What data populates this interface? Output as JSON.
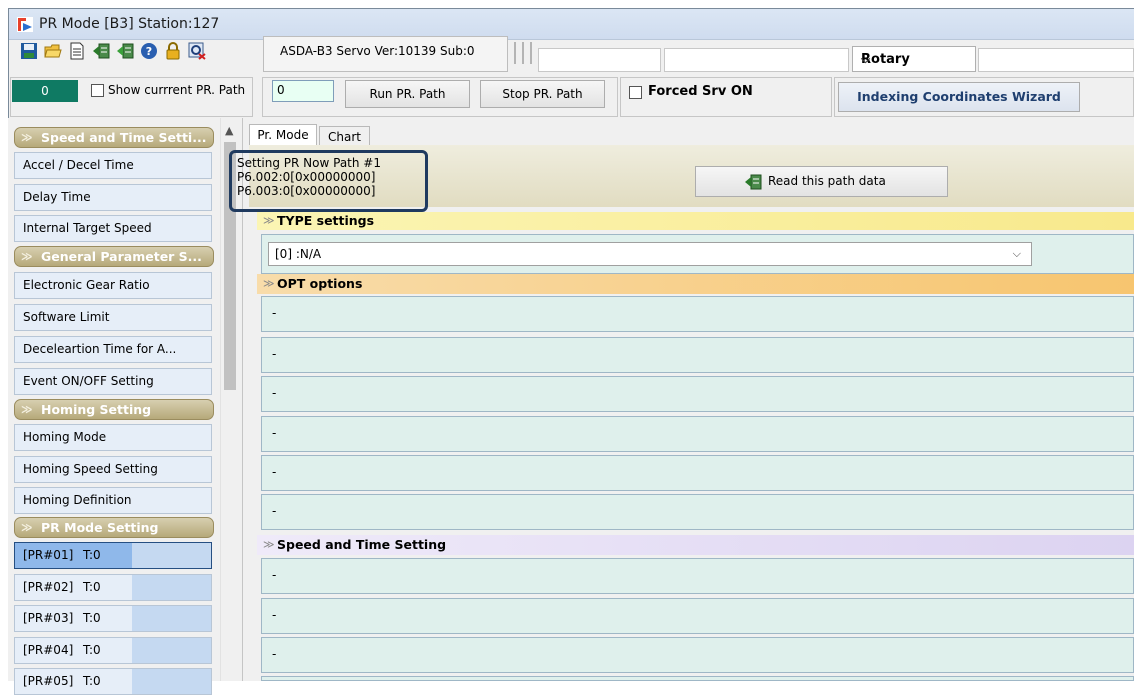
{
  "window": {
    "title": "PR Mode [B3] Station:127"
  },
  "toolbar": {
    "icons": [
      "save-icon",
      "open-folder-icon",
      "document-icon",
      "read-servo-icon",
      "write-servo-icon",
      "help-icon",
      "lock-icon",
      "search-close-icon"
    ],
    "version": "ASDA-B3 Servo Ver:10139 Sub:0",
    "mode_select": "Rotary"
  },
  "controls": {
    "status_value": "0",
    "show_path_label": "Show currrent PR. Path",
    "path_input": "0",
    "run_button": "Run PR. Path",
    "stop_button": "Stop PR. Path",
    "forced_label": "Forced Srv ON",
    "wizard_button": "Indexing Coordinates Wizard"
  },
  "sidebar": {
    "groups": [
      {
        "title": "Speed and Time Setti...",
        "items": [
          "Accel / Decel Time",
          "Delay Time",
          "Internal Target Speed"
        ]
      },
      {
        "title": "General Parameter S...",
        "items": [
          "Electronic Gear Ratio",
          "Software Limit",
          "Deceleartion Time for A...",
          "Event ON/OFF Setting"
        ]
      },
      {
        "title": "Homing Setting",
        "items": [
          "Homing Mode",
          "Homing Speed Setting",
          "Homing Definition"
        ]
      },
      {
        "title": "PR Mode Setting",
        "paths": [
          {
            "name": "[PR#01]",
            "t": "T:0"
          },
          {
            "name": "[PR#02]",
            "t": "T:0"
          },
          {
            "name": "[PR#03]",
            "t": "T:0"
          },
          {
            "name": "[PR#04]",
            "t": "T:0"
          },
          {
            "name": "[PR#05]",
            "t": "T:0"
          }
        ]
      }
    ]
  },
  "tabs": [
    "Pr. Mode",
    "Chart"
  ],
  "info": {
    "line1": "Setting PR Now Path #1",
    "line2": "P6.002:0[0x00000000]",
    "line3": "P6.003:0[0x00000000]",
    "read_button": "Read this path data"
  },
  "sections": {
    "type_title": "TYPE settings",
    "type_value": "[0] :N/A",
    "opt_title": "OPT options",
    "opt_rows": [
      "-",
      "-",
      "-",
      "-",
      "-",
      "-"
    ],
    "speed_title": "Speed and Time Setting",
    "speed_rows": [
      "-",
      "-",
      "-"
    ]
  }
}
